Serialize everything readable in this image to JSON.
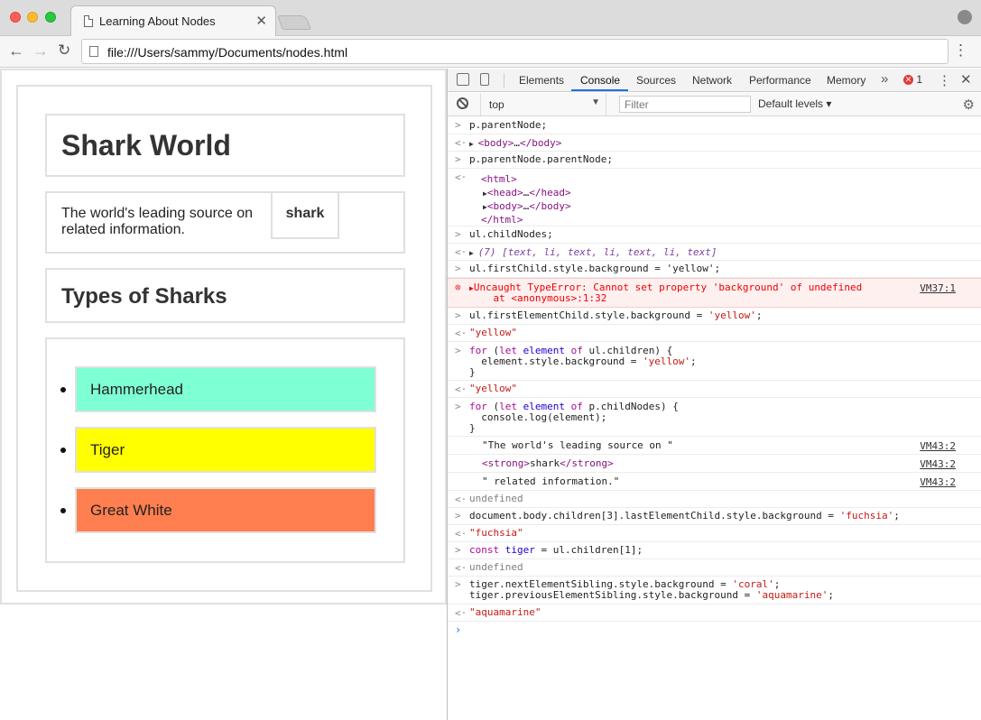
{
  "browser": {
    "tab_title": "Learning About Nodes",
    "tab_close": "✕",
    "url": "file:///Users/sammy/Documents/nodes.html"
  },
  "page": {
    "h1": "Shark World",
    "paragraph": "The world's leading source on related information.",
    "strong": "shark",
    "h2": "Types of Sharks",
    "list": [
      {
        "label": "Hammerhead",
        "color": "#7fffd4"
      },
      {
        "label": "Tiger",
        "color": "#ffff00"
      },
      {
        "label": "Great White",
        "color": "#ff7f50"
      }
    ]
  },
  "devtools": {
    "tabs": [
      "Elements",
      "Console",
      "Sources",
      "Network",
      "Performance",
      "Memory"
    ],
    "active_tab": "Console",
    "overflow": "»",
    "error_count": "1",
    "context": "top",
    "filter_placeholder": "Filter",
    "levels": "Default levels ▾"
  },
  "console": {
    "r1": "p.parentNode;",
    "r2a": "<body>",
    "r2b": "…",
    "r2c": "</body>",
    "r3": "p.parentNode.parentNode;",
    "r4_html": "<html>",
    "r4_head": "<head>",
    "r4_headc": "</head>",
    "r4_body": "<body>",
    "r4_bodyc": "</body>",
    "r4_htmlc": "</html>",
    "r4_ell": "…",
    "r5": "ul.childNodes;",
    "r6": "(7) [text, li, text, li, text, li, text]",
    "r7": "ul.firstChild.style.background = 'yellow';",
    "r8a": "Uncaught TypeError: Cannot set property 'background' of undefined",
    "r8b": "    at <anonymous>:1:32",
    "r8src": "VM37:1",
    "r9": "ul.firstElementChild.style.background = 'yellow';",
    "r10": "\"yellow\"",
    "r11a": "for (let element of ul.children) {",
    "r11b": "  element.style.background = 'yellow';",
    "r11c": "}",
    "r12": "\"yellow\"",
    "r13a": "for (let element of p.childNodes) {",
    "r13b": "  console.log(element);",
    "r13c": "}",
    "r14": "\"The world's leading source on \"",
    "r14src": "VM43:2",
    "r15a": "<strong>",
    "r15b": "shark",
    "r15c": "</strong>",
    "r15src": "VM43:2",
    "r16": "\" related information.\"",
    "r16src": "VM43:2",
    "r17": "undefined",
    "r18": "document.body.children[3].lastElementChild.style.background = 'fuchsia';",
    "r19": "\"fuchsia\"",
    "r20": "const tiger = ul.children[1];",
    "r21": "undefined",
    "r22a": "tiger.nextElementSibling.style.background = 'coral';",
    "r22b": "tiger.previousElementSibling.style.background = 'aquamarine';",
    "r23": "\"aquamarine\"",
    "prompt": "›"
  }
}
